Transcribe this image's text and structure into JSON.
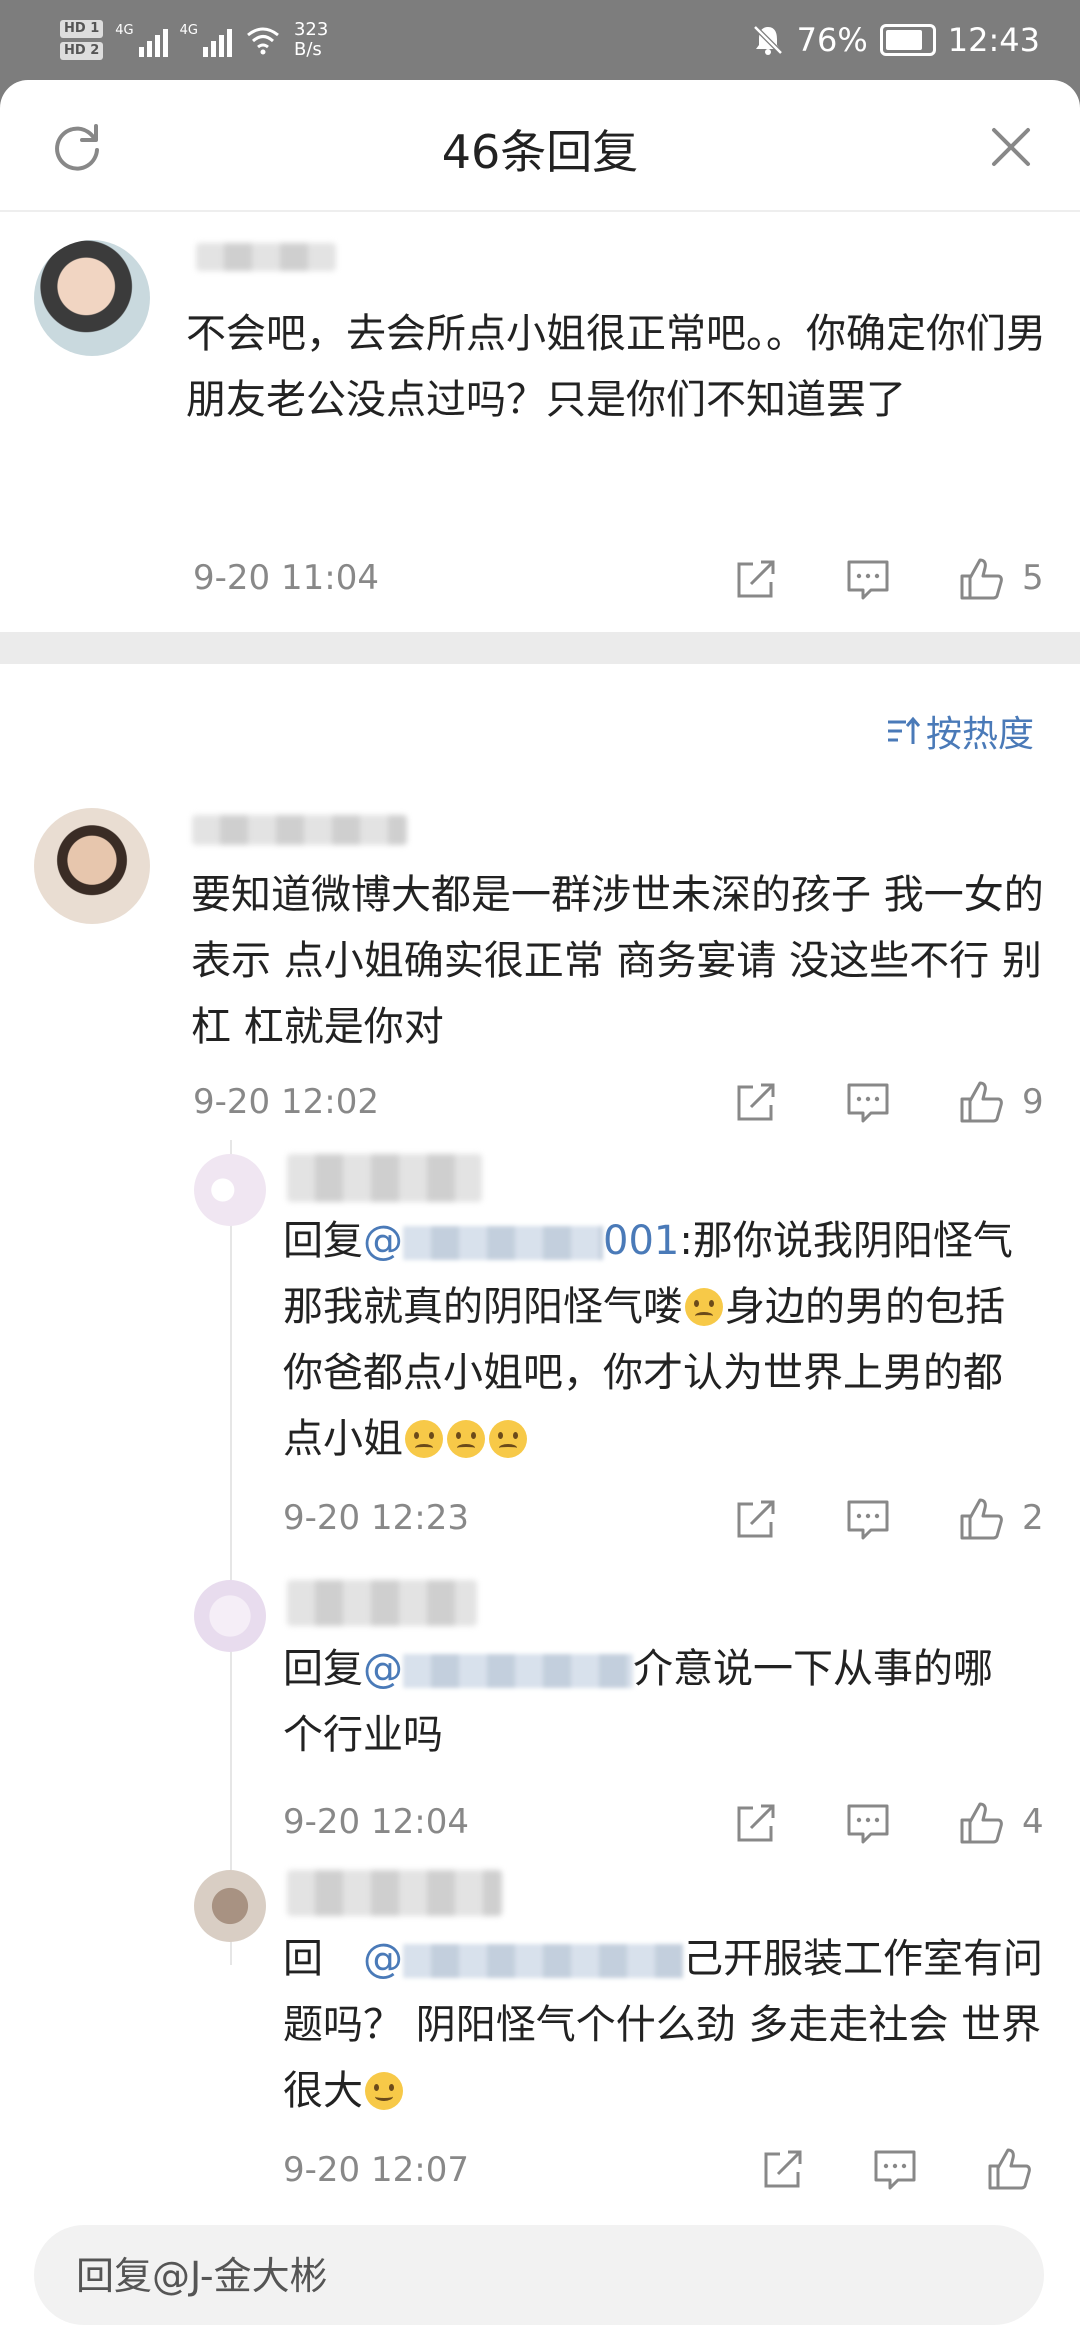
{
  "status_bar": {
    "sim1": "HD 1",
    "sim2": "HD 2",
    "net1": "4G",
    "net2": "4G",
    "speed": "323\nB/s",
    "battery": "76%",
    "time": "12:43"
  },
  "header": {
    "title": "46条回复",
    "refresh_icon": "refresh-icon",
    "close_icon": "close-icon"
  },
  "root_comment": {
    "text": "不会吧，去会所点小姐很正常吧。。你确定你们男朋友老公没点过吗？只是你们不知道罢了",
    "timestamp": "9-20 11:04",
    "like_count": "5"
  },
  "sort": {
    "label": "按热度",
    "icon": "sort-icon"
  },
  "comments": [
    {
      "text": "要知道微博大都是一群涉世未深的孩子 我一女的表示 点小姐确实很正常 商务宴请 没这些不行 别杠 杠就是你对",
      "timestamp": "9-20 12:02",
      "like_count": "9"
    }
  ],
  "replies": [
    {
      "prefix": "回复",
      "mention": "@",
      "mention_tail": "001",
      "text": ":那你说我阴阳怪气那我就真的阴阳怪气喽",
      "text2": "身边的男的包括你爸都点小姐吧，你才认为世界上男的都点小姐",
      "timestamp": "9-20 12:23",
      "like_count": "2"
    },
    {
      "prefix": "回复",
      "mention": "@",
      "text": "介意说一下从事的哪个行业吗",
      "timestamp": "9-20 12:04",
      "like_count": "4"
    },
    {
      "prefix": "回",
      "mention": "@",
      "text": "己开服装工作室有问题吗？ 阴阳怪气个什么劲 多走走社会 世界很大",
      "timestamp": "9-20 12:07",
      "like_count": ""
    }
  ],
  "reply_input": {
    "placeholder": "回复@J-金大彬"
  },
  "colors": {
    "accent": "#4a7ab8",
    "timestamp": "#888888",
    "divider": "#ebebeb"
  }
}
